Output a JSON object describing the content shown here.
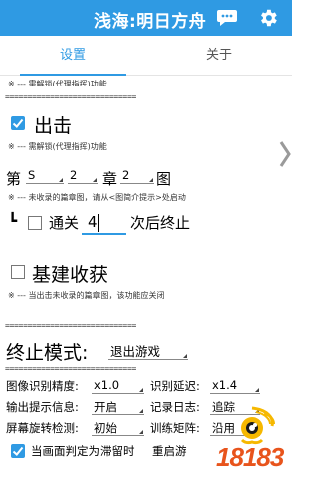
{
  "app": {
    "title": "浅海:明日方舟",
    "accent_color": "#2f9ae3",
    "chat_icon": "chat-bubble-icon",
    "settings_icon": "gear-icon"
  },
  "tabs": [
    {
      "label": "设置",
      "active": true
    },
    {
      "label": "关于",
      "active": false
    }
  ],
  "top_note": "※ --- 需解锁(代理指挥)功能",
  "separator": "=============================",
  "sortie": {
    "label": "出击",
    "checked": true,
    "note": "※ --- 需解锁(代理指挥)功能"
  },
  "stage": {
    "prefix": "第",
    "s_value": "S",
    "num1": "2",
    "chapter": "章",
    "num2": "2",
    "map": "图",
    "note": "※ --- 未收录的篇章图，请从<图简介提示>处启动"
  },
  "clear": {
    "branch": "┗",
    "label": "通关",
    "checked": false,
    "count": "4",
    "suffix": "次后终止"
  },
  "base": {
    "label": "基建收获",
    "checked": false,
    "note": "※ --- 当出击未收录的篇章图，该功能应关闭"
  },
  "terminate": {
    "label": "终止模式:",
    "value": "退出游戏"
  },
  "settings": {
    "image_precision_label": "图像识别精度:",
    "image_precision_value": "x1.0",
    "recog_delay_label": "识别延迟:",
    "recog_delay_value": "x1.4",
    "output_label": "输出提示信息:",
    "output_value": "开启",
    "log_label": "记录日志:",
    "log_value": "追踪",
    "rotate_label": "屏幕旋转检测:",
    "rotate_value": "初始",
    "matrix_label": "训练矩阵:",
    "matrix_value": "沿用"
  },
  "stuck": {
    "label": "当画面判定为滞留时",
    "action": "重启游",
    "checked": true
  },
  "watermark": {
    "text": "18183",
    "icon": "watermark-logo-icon"
  }
}
